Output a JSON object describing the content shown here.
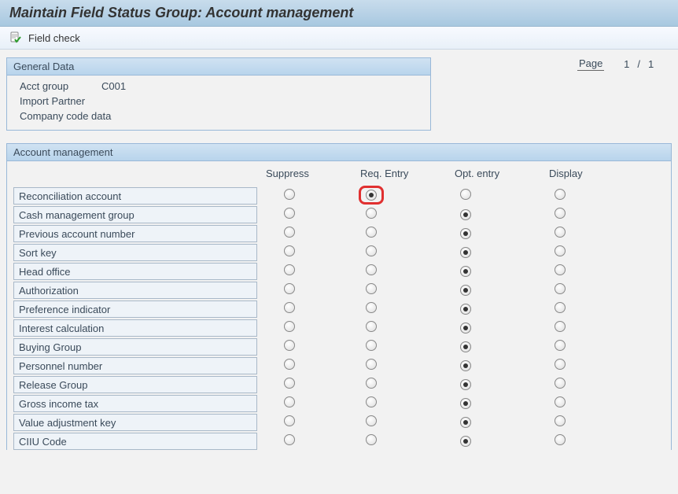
{
  "title": "Maintain Field Status Group: Account management",
  "toolbar": {
    "field_check_label": "Field check"
  },
  "general_data": {
    "header": "General Data",
    "rows": [
      {
        "label": "Acct group",
        "value": "C001"
      },
      {
        "label": "Import Partner",
        "value": ""
      },
      {
        "label": "Company code data",
        "value": ""
      }
    ]
  },
  "page_info": {
    "label": "Page",
    "current": "1",
    "sep": "/",
    "total": "1"
  },
  "section": {
    "header": "Account management",
    "columns": [
      "Suppress",
      "Req. Entry",
      "Opt. entry",
      "Display"
    ],
    "rows": [
      {
        "label": "Reconciliation account",
        "selected": 1,
        "highlight": true
      },
      {
        "label": "Cash management group",
        "selected": 2
      },
      {
        "label": "Previous account number",
        "selected": 2
      },
      {
        "label": "Sort key",
        "selected": 2
      },
      {
        "label": "Head office",
        "selected": 2
      },
      {
        "label": "Authorization",
        "selected": 2
      },
      {
        "label": "Preference indicator",
        "selected": 2
      },
      {
        "label": "Interest calculation",
        "selected": 2
      },
      {
        "label": "Buying Group",
        "selected": 2
      },
      {
        "label": "Personnel number",
        "selected": 2
      },
      {
        "label": "Release Group",
        "selected": 2
      },
      {
        "label": "Gross income tax",
        "selected": 2
      },
      {
        "label": "Value adjustment key",
        "selected": 2
      },
      {
        "label": "CIIU Code",
        "selected": 2
      }
    ]
  }
}
